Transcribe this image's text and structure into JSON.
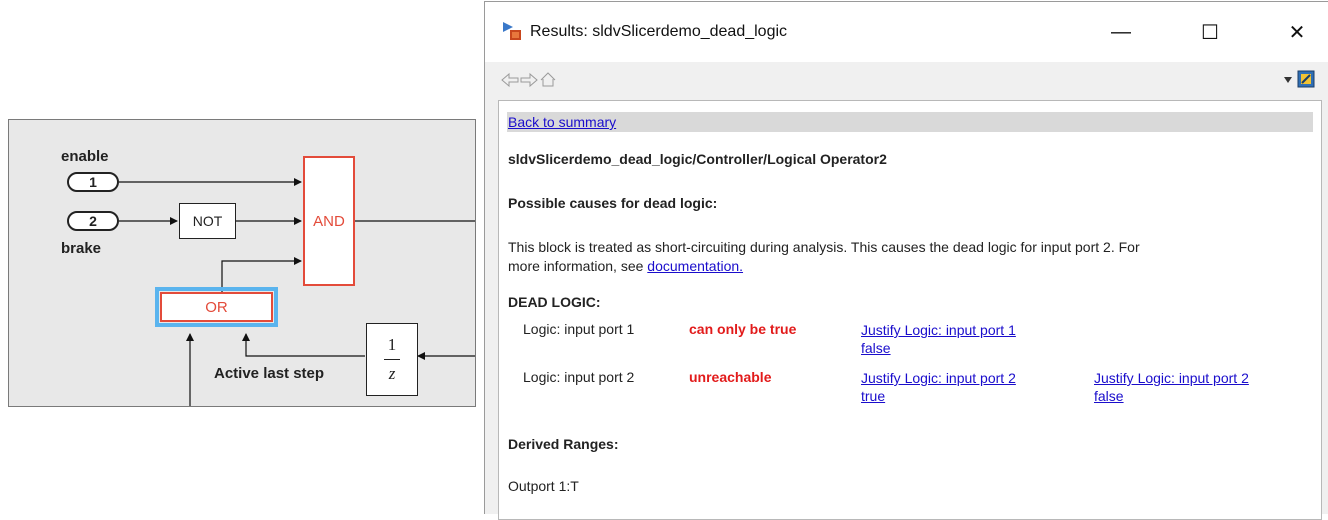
{
  "diagram": {
    "signals": {
      "enable": "enable",
      "brake": "brake",
      "active_last_step": "Active last step"
    },
    "ports": {
      "port1": "1",
      "port2": "2"
    },
    "blocks": {
      "not": "NOT",
      "and": "AND",
      "or": "OR",
      "delay_num": "1",
      "delay_den": "z"
    },
    "colors": {
      "highlight_red": "#e34b3a",
      "selection_blue": "#5ab4ee"
    }
  },
  "window": {
    "title": "Results: sldvSlicerdemo_dead_logic",
    "controls": {
      "minimize": "—",
      "maximize": "☐",
      "close": "✕"
    },
    "toolbar": {
      "back_icon": "arrow-left-icon",
      "forward_icon": "arrow-right-icon",
      "home_icon": "home-icon",
      "dropdown_icon": "dropdown-icon",
      "highlight_icon": "highlight-model-icon"
    },
    "content": {
      "back_link": "Back to summary",
      "block_path": "sldvSlicerdemo_dead_logic/Controller/Logical Operator2",
      "causes_heading": "Possible causes for dead logic:",
      "causes_text_1": "This block is treated as short-circuiting during analysis. This causes the dead logic for input port 2. For",
      "causes_text_2": "more information, see ",
      "doc_link": "documentation.",
      "dead_logic_heading": "DEAD LOGIC:",
      "dead_logic": [
        {
          "logic": "Logic: input port 1",
          "status": "can only be true",
          "justify_1_line1": "Justify Logic: input port 1",
          "justify_1_line2": "false"
        },
        {
          "logic": "Logic: input port 2",
          "status": "unreachable",
          "justify_1_line1": "Justify Logic: input port 2",
          "justify_1_line2": "true",
          "justify_2_line1": "Justify Logic: input port 2",
          "justify_2_line2": "false"
        }
      ],
      "derived_heading": "Derived Ranges:",
      "derived_value": "Outport 1:T"
    },
    "colors": {
      "link": "#1a0dcc",
      "status_red": "#e21b1b",
      "summary_bar": "#d9d9d9"
    }
  }
}
